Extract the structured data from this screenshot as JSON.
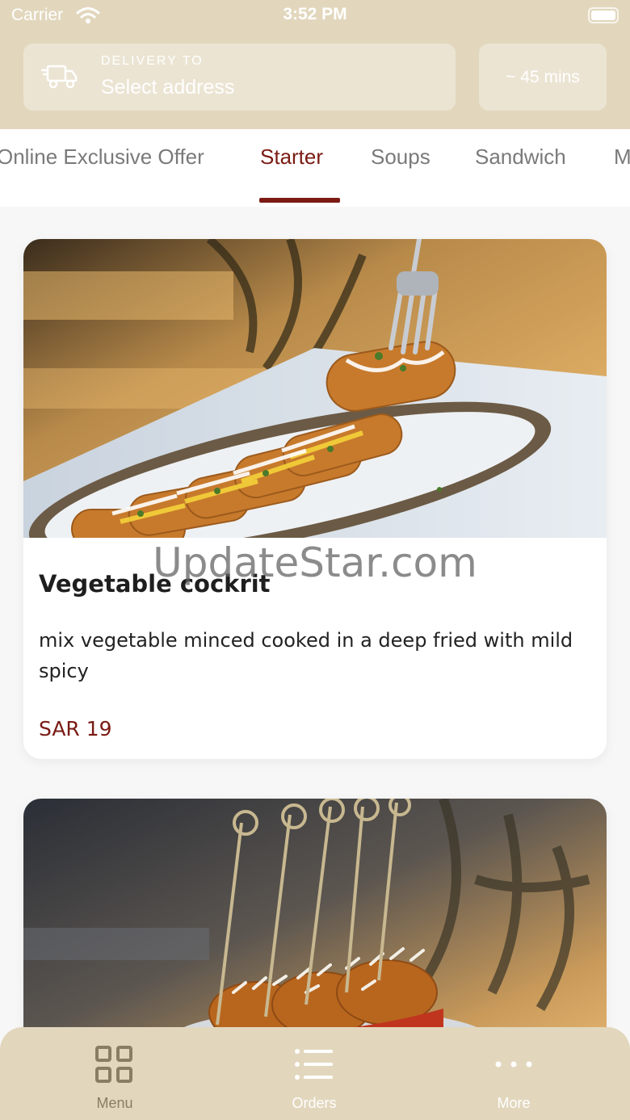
{
  "status_bar": {
    "carrier": "Carrier",
    "time": "3:52 PM"
  },
  "header": {
    "delivery_label": "DELIVERY TO",
    "delivery_value": "Select address",
    "delivery_time": "~ 45 mins"
  },
  "tabs": [
    {
      "label": "Online Exclusive Offer"
    },
    {
      "label": "Starter"
    },
    {
      "label": "Soups"
    },
    {
      "label": "Sandwich"
    },
    {
      "label": "M"
    }
  ],
  "active_tab": "Starter",
  "watermark": "UpdateStar.com",
  "items": [
    {
      "title": "Vegetable cockrit",
      "description": "mix vegetable minced cooked in a deep fried with mild spicy",
      "price": "SAR 19"
    }
  ],
  "bottom_nav": [
    {
      "label": "Menu",
      "icon": "grid-icon",
      "active": true
    },
    {
      "label": "Orders",
      "icon": "list-icon",
      "active": false
    },
    {
      "label": "More",
      "icon": "dots-icon",
      "active": false
    }
  ],
  "colors": {
    "header_bg": "#e2d7bd",
    "accent": "#7a1b14",
    "inactive_tab": "#7a7a7a"
  }
}
